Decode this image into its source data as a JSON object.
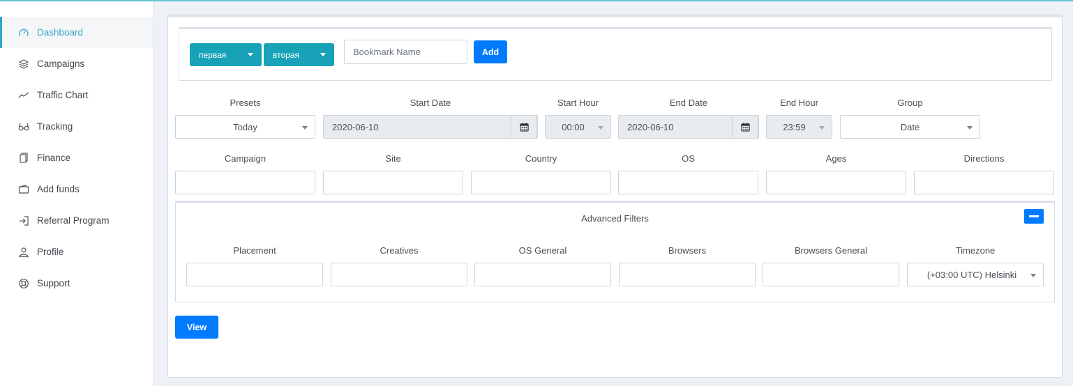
{
  "sidebar": {
    "items": [
      {
        "label": "Dashboard",
        "icon": "dashboard-icon",
        "active": true
      },
      {
        "label": "Campaigns",
        "icon": "layers-icon"
      },
      {
        "label": "Traffic Chart",
        "icon": "trend-line-icon"
      },
      {
        "label": "Tracking",
        "icon": "glasses-icon"
      },
      {
        "label": "Finance",
        "icon": "document-copy-icon"
      },
      {
        "label": "Add funds",
        "icon": "wallet-icon"
      },
      {
        "label": "Referral Program",
        "icon": "sign-in-icon"
      },
      {
        "label": "Profile",
        "icon": "user-icon"
      },
      {
        "label": "Support",
        "icon": "lifebuoy-icon"
      }
    ]
  },
  "bookmarks": {
    "tabs": [
      {
        "label": "первая"
      },
      {
        "label": "вторая"
      }
    ],
    "name_placeholder": "Bookmark Name",
    "add_label": "Add"
  },
  "filters": {
    "presets": {
      "label": "Presets",
      "value": "Today"
    },
    "start_date": {
      "label": "Start Date",
      "value": "2020-06-10"
    },
    "start_hour": {
      "label": "Start Hour",
      "value": "00:00"
    },
    "end_date": {
      "label": "End Date",
      "value": "2020-06-10"
    },
    "end_hour": {
      "label": "End Hour",
      "value": "23:59"
    },
    "group": {
      "label": "Group",
      "value": "Date"
    },
    "campaign": {
      "label": "Campaign",
      "value": ""
    },
    "site": {
      "label": "Site",
      "value": ""
    },
    "country": {
      "label": "Country",
      "value": ""
    },
    "os": {
      "label": "OS",
      "value": ""
    },
    "ages": {
      "label": "Ages",
      "value": ""
    },
    "directions": {
      "label": "Directions",
      "value": ""
    }
  },
  "advanced": {
    "title": "Advanced Filters",
    "placement": {
      "label": "Placement",
      "value": ""
    },
    "creatives": {
      "label": "Creatives",
      "value": ""
    },
    "os_general": {
      "label": "OS General",
      "value": ""
    },
    "browsers": {
      "label": "Browsers",
      "value": ""
    },
    "browsers_general": {
      "label": "Browsers General",
      "value": ""
    },
    "timezone": {
      "label": "Timezone",
      "value": "(+03:00 UTC) Helsinki"
    }
  },
  "view_label": "View",
  "colors": {
    "accent": "#2ea7c8",
    "primary": "#007bff",
    "tab": "#17a2b8"
  }
}
